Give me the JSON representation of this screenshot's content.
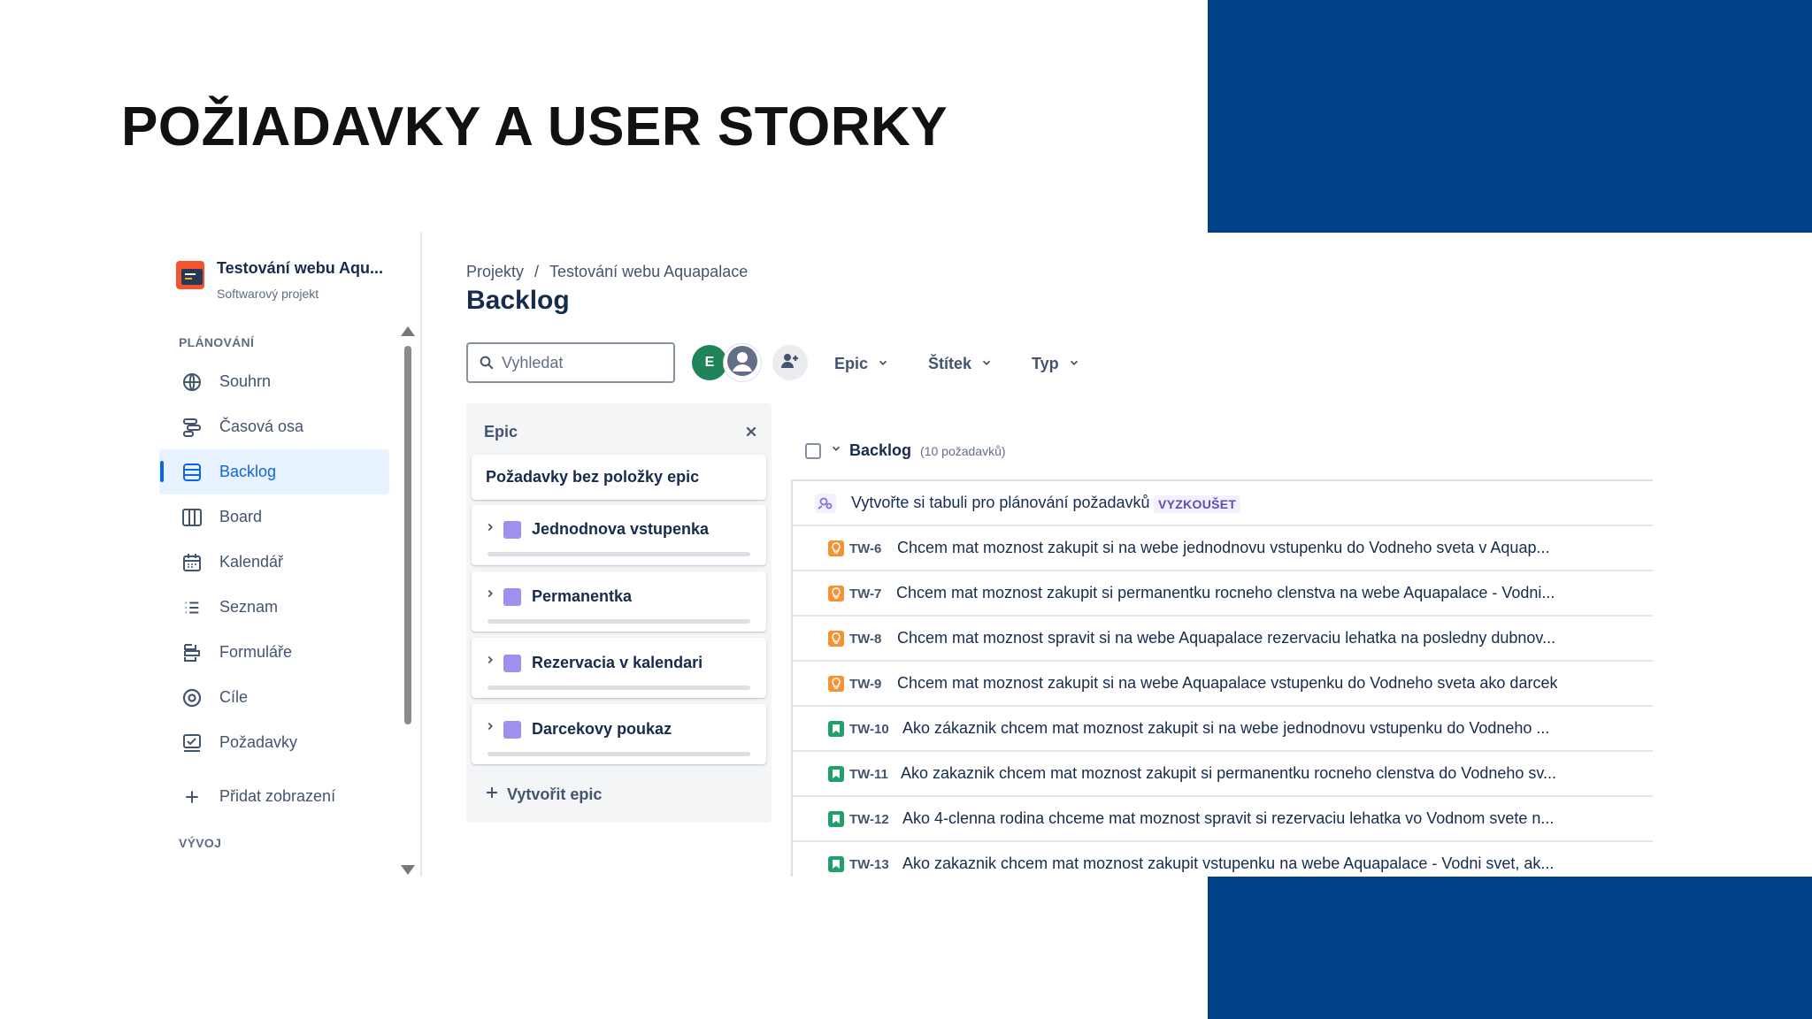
{
  "slide": {
    "title": "POŽIADAVKY A USER STORKY"
  },
  "colors": {
    "slide_blue": "#004189",
    "accent": "#0c66e4",
    "story_green": "#22a06b",
    "lightbulb_orange": "#f79233",
    "epic_purple": "#9f8fef"
  },
  "sidebar": {
    "project_name": "Testování webu Aqu...",
    "project_type": "Softwarový projekt",
    "planning_label": "PLÁNOVÁNÍ",
    "items": [
      {
        "label": "Souhrn",
        "icon": "globe-icon"
      },
      {
        "label": "Časová osa",
        "icon": "timeline-icon"
      },
      {
        "label": "Backlog",
        "icon": "backlog-icon"
      },
      {
        "label": "Board",
        "icon": "board-icon"
      },
      {
        "label": "Kalendář",
        "icon": "calendar-icon"
      },
      {
        "label": "Seznam",
        "icon": "list-icon"
      },
      {
        "label": "Formuláře",
        "icon": "forms-icon"
      },
      {
        "label": "Cíle",
        "icon": "target-icon"
      },
      {
        "label": "Požadavky",
        "icon": "requests-icon"
      }
    ],
    "active_item": "Backlog",
    "add_view_label": "Přidat zobrazení",
    "dev_label": "VÝVOJ"
  },
  "breadcrumb": {
    "projects": "Projekty",
    "separator": "/",
    "project": "Testování webu Aquapalace"
  },
  "page_title": "Backlog",
  "search": {
    "placeholder": "Vyhledat",
    "value": ""
  },
  "avatars": {
    "initial": "E"
  },
  "filters": {
    "epic": "Epic",
    "label": "Štítek",
    "type": "Typ"
  },
  "epic_panel": {
    "header": "Epic",
    "no_epic": "Požadavky bez položky epic",
    "epics": [
      {
        "name": "Jednodnova vstupenka"
      },
      {
        "name": "Permanentka"
      },
      {
        "name": "Rezervacia v kalendari"
      },
      {
        "name": "Darcekovy poukaz"
      }
    ],
    "create_label": "Vytvořit epic"
  },
  "backlog": {
    "title": "Backlog",
    "count": "(10 požadavků)",
    "promo_text": "Vytvořte si tabuli pro plánování požadavků",
    "promo_badge": "VYZKOUŠET",
    "issues": [
      {
        "key": "TW-6",
        "type": "lightbulb",
        "summary": "Chcem mat moznost zakupit si na webe jednodnovu vstupenku do Vodneho sveta v Aquap..."
      },
      {
        "key": "TW-7",
        "type": "lightbulb",
        "summary": "Chcem mat moznost zakupit si permanentku rocneho clenstva na webe Aquapalace - Vodni..."
      },
      {
        "key": "TW-8",
        "type": "lightbulb",
        "summary": "Chcem mat moznost spravit si na webe Aquapalace rezervaciu lehatka na posledny dubnov..."
      },
      {
        "key": "TW-9",
        "type": "lightbulb",
        "summary": "Chcem mat moznost zakupit si na webe Aquapalace vstupenku do Vodneho sveta ako darcek"
      },
      {
        "key": "TW-10",
        "type": "story",
        "summary": "Ako zákaznik chcem mat moznost zakupit si na webe jednodnovu vstupenku do Vodneho ..."
      },
      {
        "key": "TW-11",
        "type": "story",
        "summary": "Ako zakaznik chcem mat moznost zakupit si permanentku rocneho clenstva do Vodneho sv..."
      },
      {
        "key": "TW-12",
        "type": "story",
        "summary": "Ako 4-clenna rodina chceme mat moznost spravit si rezervaciu lehatka vo Vodnom svete n..."
      },
      {
        "key": "TW-13",
        "type": "story",
        "summary": "Ako zakaznik chcem mat moznost zakupit vstupenku na webe Aquapalace - Vodni svet, ak..."
      }
    ]
  }
}
